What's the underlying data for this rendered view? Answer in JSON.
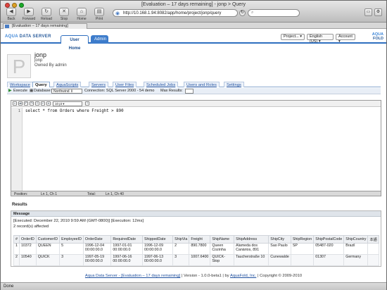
{
  "browser": {
    "window_title": "[Evaluation – 17 days remaining] - jonp > Query",
    "toolbar": [
      "Back",
      "Forward",
      "Reload",
      "Stop",
      "Home",
      "Print"
    ],
    "toolbar_icons": [
      "back-icon",
      "forward-icon",
      "reload-icon",
      "stop-icon",
      "home-icon",
      "print-icon"
    ],
    "url": "http://10.168.1.94:8082/app/home/project/jonp/query",
    "tab_title": "[Evaluation – 17 days remaining]",
    "status": "Done"
  },
  "app": {
    "brand_prefix": "AQUA",
    "brand_suffix": " DATA SERVER",
    "nav": {
      "user_home": "User Home",
      "admin": "Admin"
    },
    "header_selects": {
      "project": "Project...",
      "language": "English (US)",
      "account": "Account"
    },
    "logo_r1": "AQUA",
    "logo_r2": "FOLD"
  },
  "profile": {
    "name": "jonp",
    "username": "jonp",
    "owner": "Owned By admin",
    "avatar_letter": "P"
  },
  "subtabs": [
    "Workspace",
    "Query",
    "AquaScripts",
    "Servers",
    "User Files",
    "Scheduled Jobs",
    "Users and Roles",
    "Settings"
  ],
  "active_subtab": "Query",
  "query_bar": {
    "execute": "Execute",
    "database_label": "Database:",
    "database": "Northwind",
    "connection": "Connection: SQL Server 2000 - 54 demo",
    "max_results": "Max Results:"
  },
  "editor": {
    "font_size": "10 pt",
    "line_number": "1",
    "sql": "select * from Orders where Freight > 890",
    "status_position_label": "Position:",
    "status_position": "Ln 1, Ch 1",
    "status_total_label": "Total:",
    "status_total": "Ln 1, Ch 40"
  },
  "results": {
    "title": "Results",
    "message_header": "Message",
    "message_line1": "[Executed: December 22, 2010 9:59 AM (GMT-0800)] [Execution: 12ms]",
    "message_line2": "2 record(s) affected",
    "columns": [
      "#",
      "OrderID",
      "CustomerID",
      "EmployeeID",
      "OrderDate",
      "RequiredDate",
      "ShippedDate",
      "ShipVia",
      "Freight",
      "ShipName",
      "ShipAddress",
      "ShipCity",
      "ShipRegion",
      "ShipPostalCode",
      "ShipCountry",
      "本語"
    ],
    "rows": [
      [
        "1",
        "10372",
        "QUEEN",
        "5",
        "1996-12-04 00:00:00.0",
        "1997-01-01 00:00:00.0",
        "1996-12-09 00:00:00.0",
        "2",
        "890.7800",
        "Queen Cozinha",
        "Alameda dos Canàrios, 891",
        "Sao Paulo",
        "SP",
        "05487-020",
        "Brazil",
        ""
      ],
      [
        "2",
        "10540",
        "QUICK",
        "3",
        "1997-05-19 00:00:00.0",
        "1997-06-16 00:00:00.0",
        "1997-06-13 00:00:00.0",
        "3",
        "1007.6400",
        "QUICK-Stop",
        "Taucherstraße 10",
        "Cunewalde",
        "",
        "01307",
        "Germany",
        ""
      ]
    ]
  },
  "footer": {
    "link1": "Aqua Data Server - [Evaluation – 17 days remaining]",
    "mid": " | Version - 1.0.0-beta1 | by ",
    "link2": "AquaFold, Inc.",
    "end": " | Copyright © 2009-2010"
  }
}
